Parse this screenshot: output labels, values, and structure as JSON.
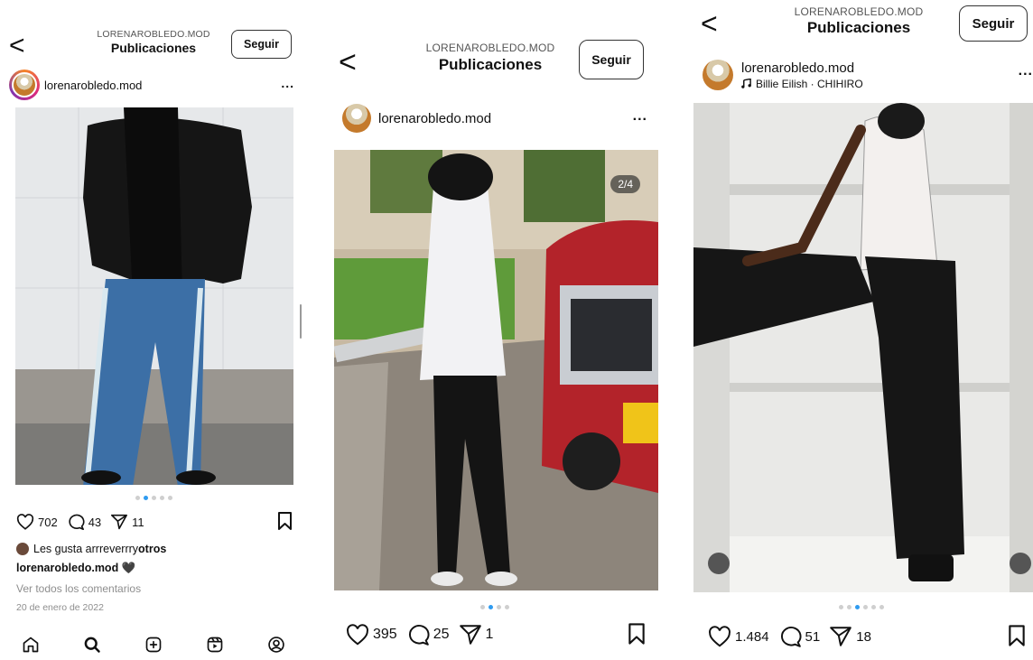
{
  "posts": [
    {
      "header": {
        "back_label": "<",
        "sub": "LORENAROBLEDO.MOD",
        "title": "Publicaciones",
        "follow_label": "Seguir"
      },
      "user": {
        "username": "lorenarobledo.mod",
        "more_label": "..."
      },
      "carousel": {
        "total": 5,
        "active": 1
      },
      "likes": "702",
      "comments": "43",
      "shares": "11",
      "liked_by": {
        "prefix": "Les gusta a ",
        "user": "rrreverrr",
        "middle": " y ",
        "others": "otros"
      },
      "caption": {
        "username": "lorenarobledo.mod",
        "emoji": "🖤"
      },
      "view_comments": "Ver todos los comentarios",
      "date": "20 de enero de 2022",
      "nav": [
        "home-icon",
        "search-icon",
        "new-post-icon",
        "reels-icon",
        "profile-icon"
      ]
    },
    {
      "header": {
        "back_label": "<",
        "sub": "LORENAROBLEDO.MOD",
        "title": "Publicaciones",
        "follow_label": "Seguir"
      },
      "user": {
        "username": "lorenarobledo.mod",
        "more_label": "..."
      },
      "carousel": {
        "total": 4,
        "active": 1,
        "indicator": "2/4"
      },
      "likes": "395",
      "comments": "25",
      "shares": "1"
    },
    {
      "header": {
        "back_label": "<",
        "sub": "LORENAROBLEDO.MOD",
        "title": "Publicaciones",
        "follow_label": "Seguir"
      },
      "user": {
        "username": "lorenarobledo.mod",
        "music": "Billie Eilish · CHIHIRO",
        "more_label": "..."
      },
      "carousel": {
        "total": 6,
        "active": 2
      },
      "likes": "1.484",
      "comments": "51",
      "shares": "18"
    }
  ],
  "colors": {
    "accent_dot": "#2f9bf0",
    "muted": "#8e8e8e"
  }
}
